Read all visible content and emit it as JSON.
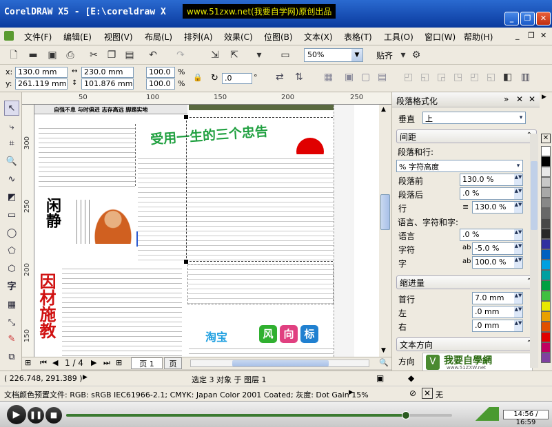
{
  "window": {
    "title": "CorelDRAW X5 - [E:\\coreldraw X",
    "watermark": "www.51zxw.net(我要自学网)原创出品",
    "buttons": {
      "minimize": "_",
      "restore": "❐",
      "close": "✕"
    }
  },
  "menubar": {
    "items": [
      "文件(F)",
      "编辑(E)",
      "视图(V)",
      "布局(L)",
      "排列(A)",
      "效果(C)",
      "位图(B)",
      "文本(X)",
      "表格(T)",
      "工具(O)",
      "窗口(W)",
      "帮助(H)"
    ]
  },
  "toolbar": {
    "zoom": "50%",
    "snap_label": "贴齐"
  },
  "propbar": {
    "x_label": "x:",
    "x_value": "130.0 mm",
    "y_label": "y:",
    "y_value": "261.119 mm",
    "w_value": "230.0 mm",
    "h_value": "101.876 mm",
    "scale_x": "100.0",
    "scale_y": "100.0",
    "percent": "%",
    "angle": ".0",
    "degree": "°"
  },
  "rulers": {
    "h_ticks": [
      "50",
      "100",
      "150",
      "200",
      "250"
    ],
    "v_ticks": [
      "300",
      "250",
      "200",
      "150"
    ]
  },
  "canvas": {
    "header_text": "自强不息 与时俱进  志存高远  脚踏实地",
    "headline": "受用一生的三个忠告",
    "calligraphy": "闲静",
    "sidebar_text": "因材施教",
    "taobao_label": "淘宝",
    "feng": "风",
    "xiang": "向",
    "biao": "标"
  },
  "pager": {
    "page_count": "1 / 4",
    "page_tab": "页 1",
    "page_tab2": "页"
  },
  "docker": {
    "title": "段落格式化",
    "align_label": "垂直",
    "align_value": "上",
    "spacing_section": "间距",
    "para_and_line": "段落和行:",
    "unit_value": "% 字符高度",
    "before_label": "段落前",
    "before_value": "130.0 %",
    "after_label": "段落后",
    "after_value": ".0 %",
    "line_label": "行",
    "line_value": "130.0 %",
    "lang_section": "语言、字符和字:",
    "lang_label": "语言",
    "lang_value": ".0 %",
    "char_label": "字符",
    "char_value": "-5.0 %",
    "word_label": "字",
    "word_value": "100.0 %",
    "indent_section": "缩进量",
    "first_label": "首行",
    "first_value": "7.0 mm",
    "left_label": "左",
    "left_value": ".0 mm",
    "right_label": "右",
    "right_value": ".0 mm",
    "textdir_section": "文本方向",
    "dir_label": "方向",
    "logo_text": "我要自學網",
    "logo_url": "www.51ZXW.net"
  },
  "status": {
    "coords": "( 226.748, 291.389 )",
    "selection": "选定 3 对象 于 图层 1",
    "color_profile": "文档颜色预置文件: RGB: sRGB IEC61966-2.1; CMYK: Japan Color 2001 Coated; 灰度: Dot Gain 15%",
    "fill_none": "无"
  },
  "player": {
    "time": "14:56 / 16:59",
    "progress_fraction": 0.88
  },
  "palette_colors": [
    "#ffffff",
    "#000000",
    "#e8e8e8",
    "#c8c8c8",
    "#a8a8a8",
    "#888888",
    "#686868",
    "#484848",
    "#282828",
    "#3030a0",
    "#0060c0",
    "#00a0e0",
    "#00a0a0",
    "#00a040",
    "#40c040",
    "#e8e800",
    "#e8a000",
    "#e05000",
    "#e00000",
    "#c00060",
    "#8040a0"
  ]
}
